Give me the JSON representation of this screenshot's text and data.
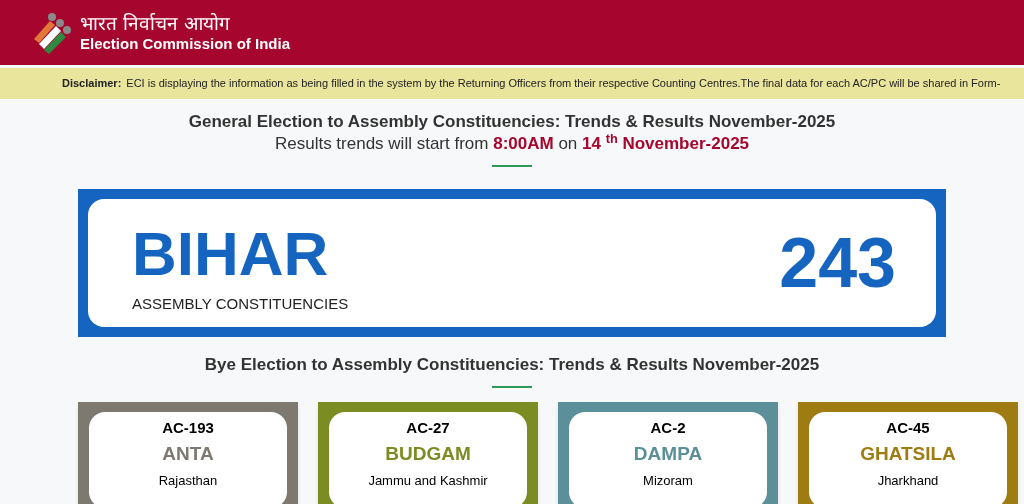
{
  "header": {
    "title_hindi": "भारत निर्वाचन आयोग",
    "title": "Election Commission of India"
  },
  "disclaimer": {
    "label": "Disclaimer:",
    "text": "ECI is displaying the information as being filled in the system by the Returning Officers from their respective Counting Centres.The final data for each AC/PC will be shared in Form-"
  },
  "general": {
    "heading": "General Election to Assembly Constituencies: Trends & Results November-2025",
    "subheading": "Results trends will start from **8:00AM** on **14 $^{th}$ November-2025**"
  },
  "state_card": {
    "state": "BIHAR",
    "label": "ASSEMBLY CONSTITUENCIES",
    "count": "243"
  },
  "bye": {
    "heading": "Bye Election to Assembly Constituencies: Trends & Results November-2025",
    "cards": [
      {
        "code": "AC-193",
        "name": "ANTA",
        "state": "Rajasthan",
        "color": "#7d7870"
      },
      {
        "code": "AC-27",
        "name": "BUDGAM",
        "state": "Jammu and Kashmir",
        "color": "#7a8c22"
      },
      {
        "code": "AC-2",
        "name": "DAMPA",
        "state": "Mizoram",
        "color": "#5b8f9a"
      },
      {
        "code": "AC-45",
        "name": "GHATSILA",
        "state": "Jharkhand",
        "color": "#9e7c12"
      }
    ]
  }
}
